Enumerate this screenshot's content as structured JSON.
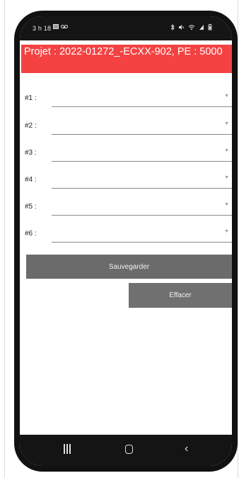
{
  "status_bar": {
    "time": "3 h 18",
    "right_icons": [
      "bluetooth-icon",
      "mute-icon",
      "wifi-icon",
      "signal-icon",
      "battery-icon"
    ]
  },
  "project": {
    "title": "Projet : 2022-01272_-ECXX-902, PE : 5000"
  },
  "fields": [
    {
      "label": "#1 :",
      "value": ""
    },
    {
      "label": "#2 :",
      "value": ""
    },
    {
      "label": "#3 :",
      "value": ""
    },
    {
      "label": "#4 :",
      "value": ""
    },
    {
      "label": "#5 :",
      "value": ""
    },
    {
      "label": "#6 :",
      "value": ""
    }
  ],
  "buttons": {
    "save": "Sauvegarder",
    "clear": "Effacer"
  },
  "colors": {
    "banner": "#f44242",
    "button": "#6b6b6b"
  }
}
